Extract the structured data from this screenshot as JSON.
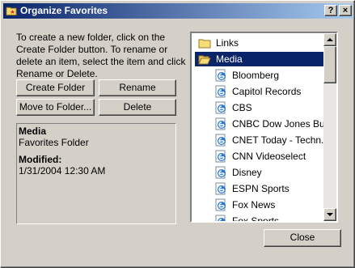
{
  "window": {
    "title": "Organize Favorites",
    "help_label": "?",
    "close_label": "×"
  },
  "description": "To create a new folder, click on the Create Folder button. To rename or delete an item, select the item and click Rename or Delete.",
  "buttons": {
    "create_folder": "Create Folder",
    "rename": "Rename",
    "move_to_folder": "Move to Folder...",
    "delete": "Delete",
    "close": "Close"
  },
  "info": {
    "name": "Media",
    "type": "Favorites Folder",
    "modified_label": "Modified:",
    "modified_value": "1/31/2004 12:30 AM"
  },
  "tree": {
    "items": [
      {
        "label": "Links",
        "icon": "folder-icon"
      },
      {
        "label": "Media",
        "icon": "open-folder-icon",
        "selected": true
      },
      {
        "label": "Bloomberg",
        "icon": "ie-page-icon"
      },
      {
        "label": "Capitol Records",
        "icon": "ie-page-icon"
      },
      {
        "label": "CBS",
        "icon": "ie-page-icon"
      },
      {
        "label": "CNBC Dow Jones Bus...",
        "icon": "ie-page-icon"
      },
      {
        "label": "CNET Today - Techn...",
        "icon": "ie-page-icon"
      },
      {
        "label": "CNN Videoselect",
        "icon": "ie-page-icon"
      },
      {
        "label": "Disney",
        "icon": "ie-page-icon"
      },
      {
        "label": "ESPN Sports",
        "icon": "ie-page-icon"
      },
      {
        "label": "Fox News",
        "icon": "ie-page-icon"
      },
      {
        "label": "Fox Sports",
        "icon": "ie-page-icon"
      }
    ]
  },
  "colors": {
    "titlebar_start": "#0a246a",
    "titlebar_end": "#a6caf0",
    "selection": "#0a246a",
    "face": "#d4d0c8"
  }
}
